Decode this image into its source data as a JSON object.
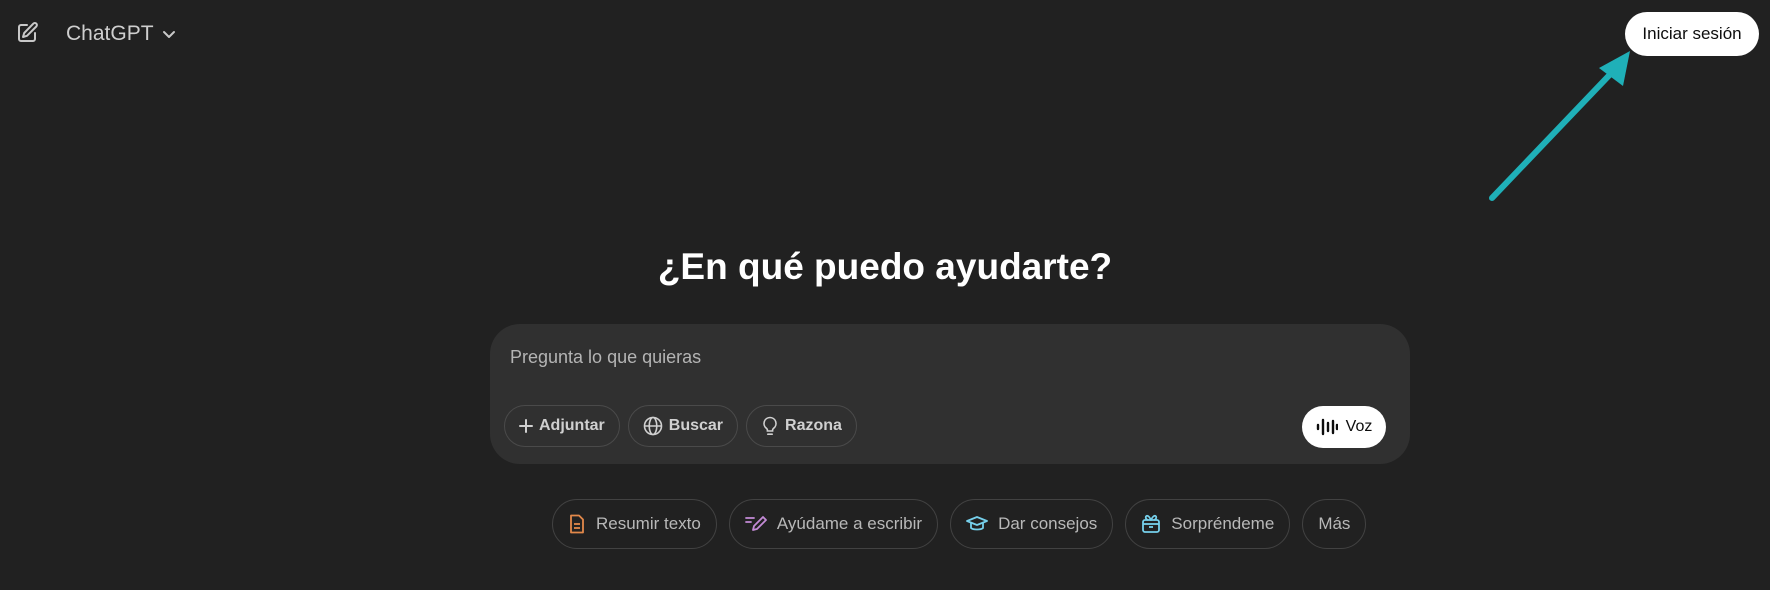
{
  "header": {
    "model_name": "ChatGPT",
    "signin_label": "Iniciar sesión"
  },
  "main": {
    "headline": "¿En qué puedo ayudarte?",
    "composer": {
      "placeholder": "Pregunta lo que quieras",
      "value": "",
      "tools": [
        {
          "label": "Adjuntar",
          "icon": "plus-icon"
        },
        {
          "label": "Buscar",
          "icon": "globe-icon"
        },
        {
          "label": "Razona",
          "icon": "lightbulb-icon"
        }
      ],
      "voice_label": "Voz"
    },
    "suggestions": [
      {
        "label": "Resumir texto",
        "icon": "document-icon",
        "color": "#e2884a"
      },
      {
        "label": "Ayúdame a escribir",
        "icon": "pen-icon",
        "color": "#c38ad6"
      },
      {
        "label": "Dar consejos",
        "icon": "graduation-cap-icon",
        "color": "#76d0eb"
      },
      {
        "label": "Sorpréndeme",
        "icon": "gift-icon",
        "color": "#76d0eb"
      },
      {
        "label": "Más",
        "icon": "",
        "color": "#b8b8b8"
      }
    ]
  },
  "annotation": {
    "arrow_color": "#1fb0b8"
  },
  "colors": {
    "background": "#212121",
    "composer": "#303030"
  }
}
